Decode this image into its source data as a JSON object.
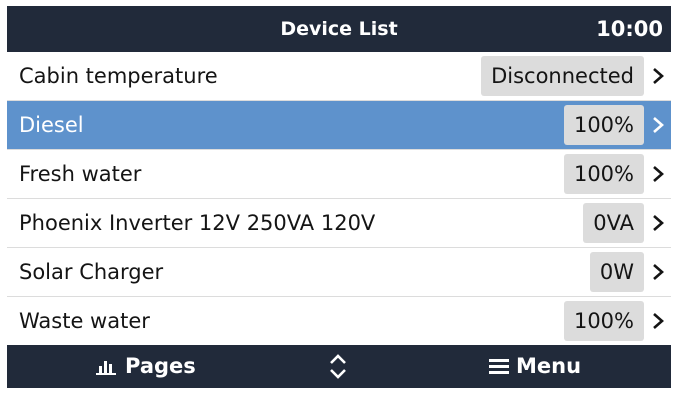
{
  "header": {
    "title": "Device List",
    "clock": "10:00"
  },
  "devices": [
    {
      "label": "Cabin temperature",
      "value": "Disconnected",
      "selected": false
    },
    {
      "label": "Diesel",
      "value": "100%",
      "selected": true
    },
    {
      "label": "Fresh water",
      "value": "100%",
      "selected": false
    },
    {
      "label": "Phoenix Inverter 12V 250VA 120V",
      "value": "0VA",
      "selected": false
    },
    {
      "label": "Solar Charger",
      "value": "0W",
      "selected": false
    },
    {
      "label": "Waste water",
      "value": "100%",
      "selected": false
    }
  ],
  "footer": {
    "pages_label": "Pages",
    "pages_icon": "bar-chart-icon",
    "navigate_icon": "up-down-arrows-icon",
    "menu_label": "Menu",
    "menu_icon": "hamburger-menu-icon"
  },
  "colors": {
    "bar_background": "#212a3a",
    "selected_row": "#5e92cc",
    "value_box": "#dcdcdc"
  }
}
